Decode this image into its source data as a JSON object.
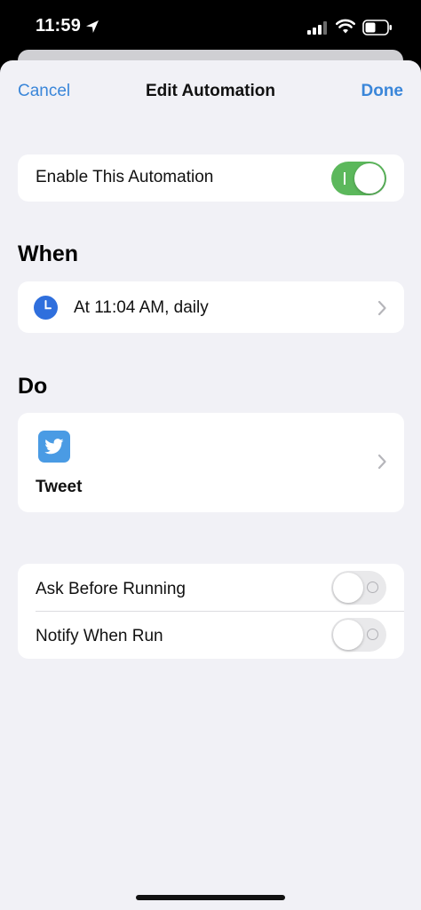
{
  "status_bar": {
    "time": "11:59",
    "icons": [
      "location-arrow-icon",
      "cellular-signal-icon",
      "wifi-icon",
      "battery-icon"
    ]
  },
  "nav": {
    "cancel_label": "Cancel",
    "title": "Edit Automation",
    "done_label": "Done"
  },
  "enable": {
    "label": "Enable This Automation",
    "enabled": true
  },
  "when": {
    "heading": "When",
    "trigger_label": "At 11:04 AM, daily",
    "icon": "clock-icon"
  },
  "do": {
    "heading": "Do",
    "action_label": "Tweet",
    "icon": "twitter-bird-icon"
  },
  "options": {
    "ask_before_running": {
      "label": "Ask Before Running",
      "enabled": false
    },
    "notify_when_run": {
      "label": "Notify When Run",
      "enabled": false
    }
  },
  "colors": {
    "accent": "#3a86d9",
    "toggle_on": "#5cb85c",
    "background": "#f1f1f6",
    "twitter_blue": "#4a9be4"
  }
}
